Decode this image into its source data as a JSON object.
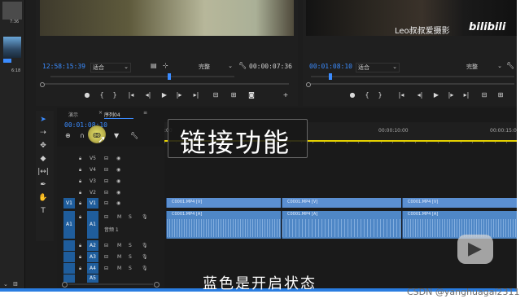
{
  "source_monitor": {
    "watermark_name": "Leo叔叔爱摄影",
    "watermark_logo": "bilibili",
    "timecode_left": "12:58:15:39",
    "fit_label": "适合",
    "full_label": "完整",
    "duration": "00:00:07:36"
  },
  "program_monitor": {
    "timecode_left": "00:01:08:10",
    "fit_label": "适合",
    "full_label": "完整"
  },
  "left_panel": {
    "label_top": "7:36",
    "label_item": "6:18"
  },
  "timeline": {
    "tabs": [
      "演示",
      "序列04"
    ],
    "active_tab": 1,
    "tab_menu_glyph": "≡",
    "timecode": "00:01:08:10",
    "ruler_labels": [
      ":00",
      "00:00:10:00",
      "00:00:15:0"
    ],
    "video_tracks": [
      "V5",
      "V4",
      "V3",
      "V2",
      "V1"
    ],
    "audio_tracks": [
      "A1",
      "A2",
      "A3",
      "A4",
      "A5"
    ],
    "source_video": "V1",
    "source_audio": "A1",
    "clip_video_label": "C0001.MP4 [V]",
    "clip_audio_label": "C0001.MP4 [A]",
    "audio_track_name": "音频 1",
    "mute_label": "M",
    "solo_label": "S"
  },
  "captions": {
    "title": "链接功能",
    "subtitle": "蓝色是开启状态"
  },
  "footer": {
    "watermark": "CSDN @yanghuagai2311"
  },
  "colors": {
    "accent": "#3b8cff",
    "clip_video": "#5b8fd1",
    "clip_audio": "#4f87c6",
    "playhead": "#e6d200"
  }
}
